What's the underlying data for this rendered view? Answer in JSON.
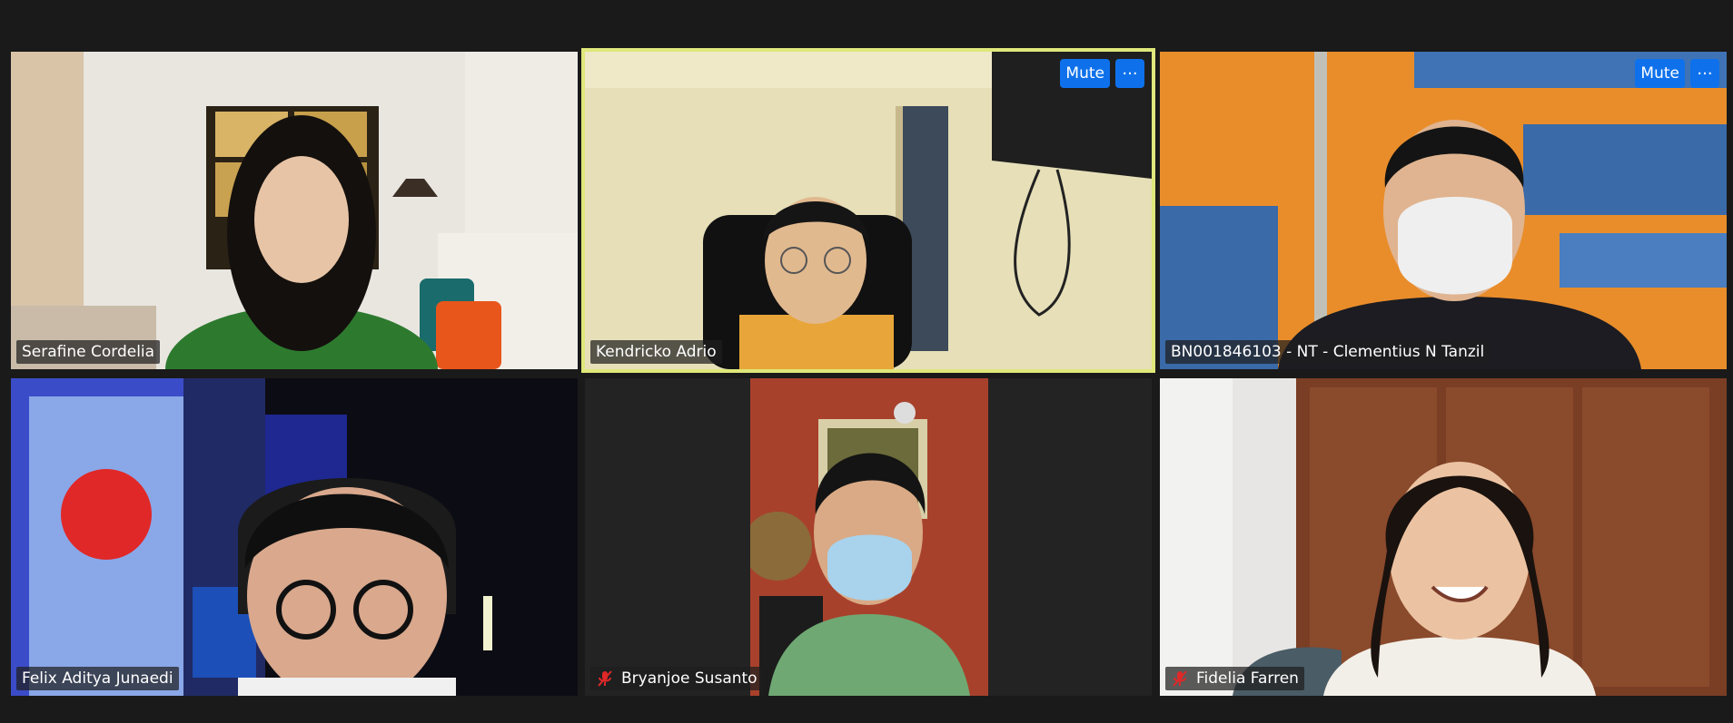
{
  "participants": [
    {
      "name": "Serafine Cordelia",
      "muted": false
    },
    {
      "name": "Kendricko Adrio",
      "muted": false,
      "active_speaker": true,
      "controls": {
        "mute_label": "Mute",
        "more_label": "···"
      }
    },
    {
      "name": "BN001846103 - NT - Clementius N Tanzil",
      "muted": false,
      "controls": {
        "mute_label": "Mute",
        "more_label": "···"
      }
    },
    {
      "name": "Felix Aditya Junaedi",
      "muted": false
    },
    {
      "name": "Bryanjoe Susanto",
      "muted": true
    },
    {
      "name": "Fidelia Farren",
      "muted": true
    }
  ],
  "colors": {
    "background": "#1a1a1a",
    "active_speaker_border": "#dfe87a",
    "button": "#0e71eb",
    "muted_icon": "#e02828"
  }
}
